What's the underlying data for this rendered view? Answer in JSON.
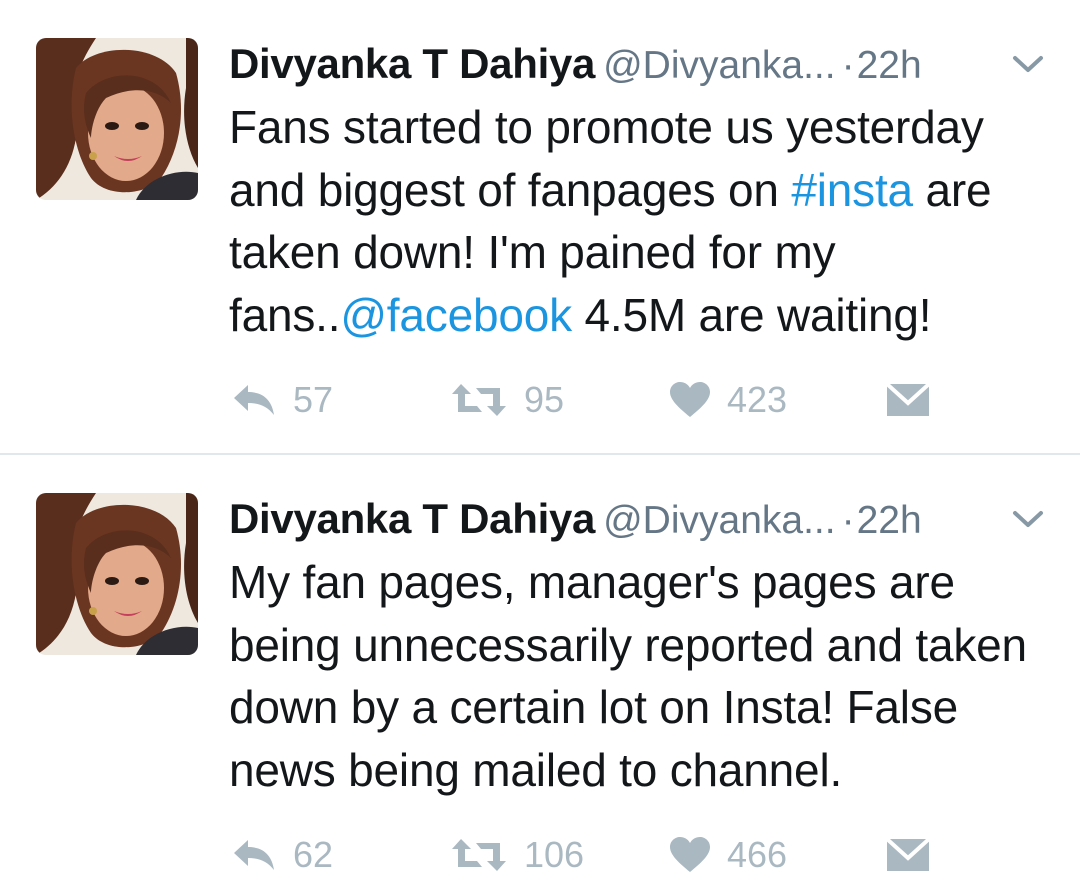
{
  "tweets": [
    {
      "author_name": "Divyanka T Dahiya",
      "handle": "@Divyanka...",
      "separator": "·",
      "time": "22h",
      "text_parts": [
        {
          "text": "Fans started to promote us yesterday and biggest of fanpages on ",
          "type": "text"
        },
        {
          "text": "#insta",
          "type": "hashtag"
        },
        {
          "text": " are taken down! I'm pained for my fans..",
          "type": "text"
        },
        {
          "text": "@facebook",
          "type": "mention"
        },
        {
          "text": " 4.5M are waiting!",
          "type": "text"
        }
      ],
      "replies": "57",
      "retweets": "95",
      "likes": "423",
      "icons": {
        "avatar": "profile-photo",
        "menu": "chevron-down-icon",
        "reply": "reply-icon",
        "retweet": "retweet-icon",
        "like": "heart-icon",
        "dm": "envelope-icon"
      }
    },
    {
      "author_name": "Divyanka T Dahiya",
      "handle": "@Divyanka...",
      "separator": "·",
      "time": "22h",
      "text_parts": [
        {
          "text": "My fan pages, manager's pages are being unnecessarily reported and taken down by a certain lot on Insta! False news being mailed to channel.",
          "type": "text"
        }
      ],
      "replies": "62",
      "retweets": "106",
      "likes": "466",
      "icons": {
        "avatar": "profile-photo",
        "menu": "chevron-down-icon",
        "reply": "reply-icon",
        "retweet": "retweet-icon",
        "like": "heart-icon",
        "dm": "envelope-icon"
      }
    }
  ],
  "colors": {
    "text": "#14171a",
    "secondary": "#657786",
    "link": "#1b95e0",
    "action": "#aab8c2",
    "divider": "#e1e8ed"
  }
}
